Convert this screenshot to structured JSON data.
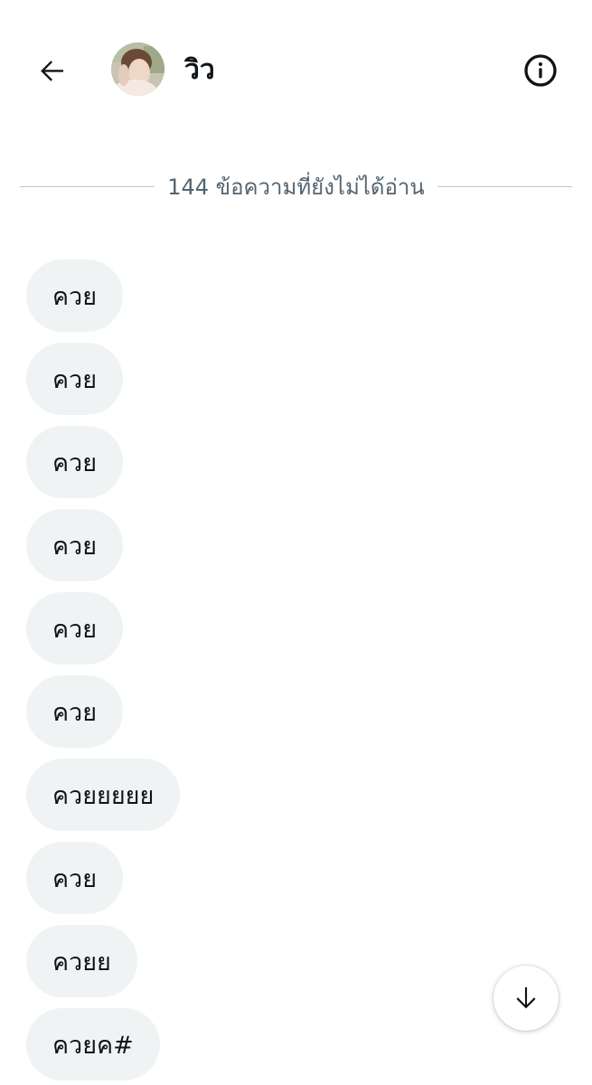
{
  "header": {
    "contact_name": "วิว",
    "back_icon": "arrow-left-icon",
    "info_icon": "info-circle-icon"
  },
  "unread_divider": {
    "text": "144 ข้อความที่ยังไม่ได้อ่าน"
  },
  "messages": [
    {
      "text": "ควย"
    },
    {
      "text": "ควย"
    },
    {
      "text": "ควย"
    },
    {
      "text": "ควย"
    },
    {
      "text": "ควย"
    },
    {
      "text": "ควย"
    },
    {
      "text": "ควยยยยย"
    },
    {
      "text": "ควย"
    },
    {
      "text": "ควยย"
    },
    {
      "text": "ควยค#"
    }
  ],
  "scroll_button": {
    "icon": "arrow-down-icon"
  },
  "colors": {
    "bubble_bg": "#eff3f4",
    "divider_line": "#b9c6cc",
    "secondary_text": "#536471",
    "primary_text": "#0f1419"
  }
}
